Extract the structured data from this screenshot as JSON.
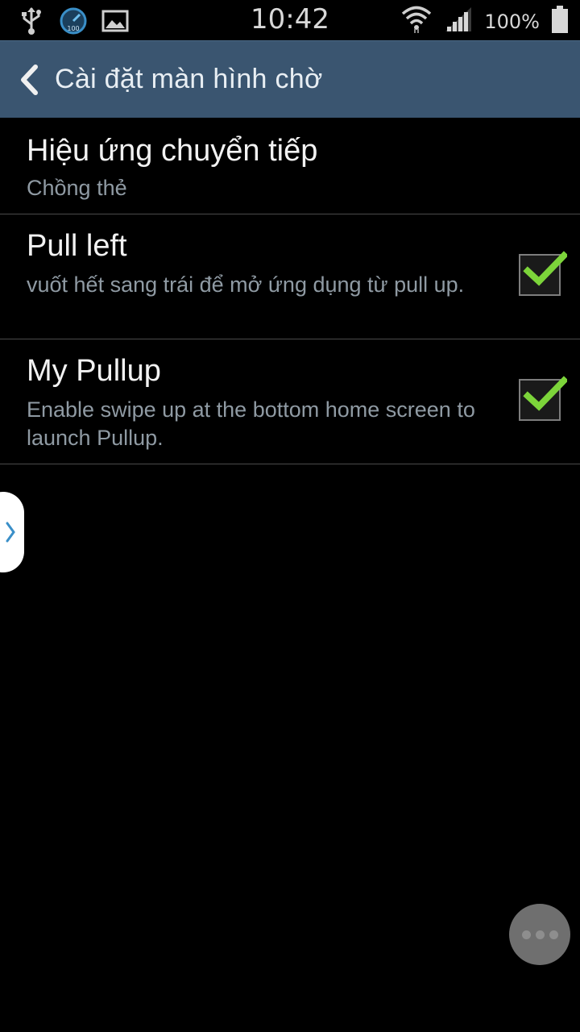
{
  "status_bar": {
    "time": "10:42",
    "battery_text": "100%",
    "icons": [
      "usb-icon",
      "speedometer-icon",
      "image-icon",
      "wifi-icon",
      "signal-icon",
      "battery-icon"
    ],
    "speed_badge": "100"
  },
  "action_bar": {
    "title": "Cài đặt màn hình chờ",
    "back_icon": "chevron-left-icon"
  },
  "settings": {
    "items": [
      {
        "title": "Hiệu ứng chuyển tiếp",
        "subtitle": "Chồng thẻ"
      },
      {
        "title": "Pull left",
        "subtitle": "vuốt hết sang trái để mở ứng dụng từ pull up.",
        "checked": true
      },
      {
        "title": "My Pullup",
        "subtitle": "Enable swipe up at the bottom home screen to launch Pullup.",
        "checked": true
      }
    ]
  },
  "colors": {
    "action_bar": "#3a5570",
    "check_green": "#7cd43a",
    "background": "#000000"
  }
}
